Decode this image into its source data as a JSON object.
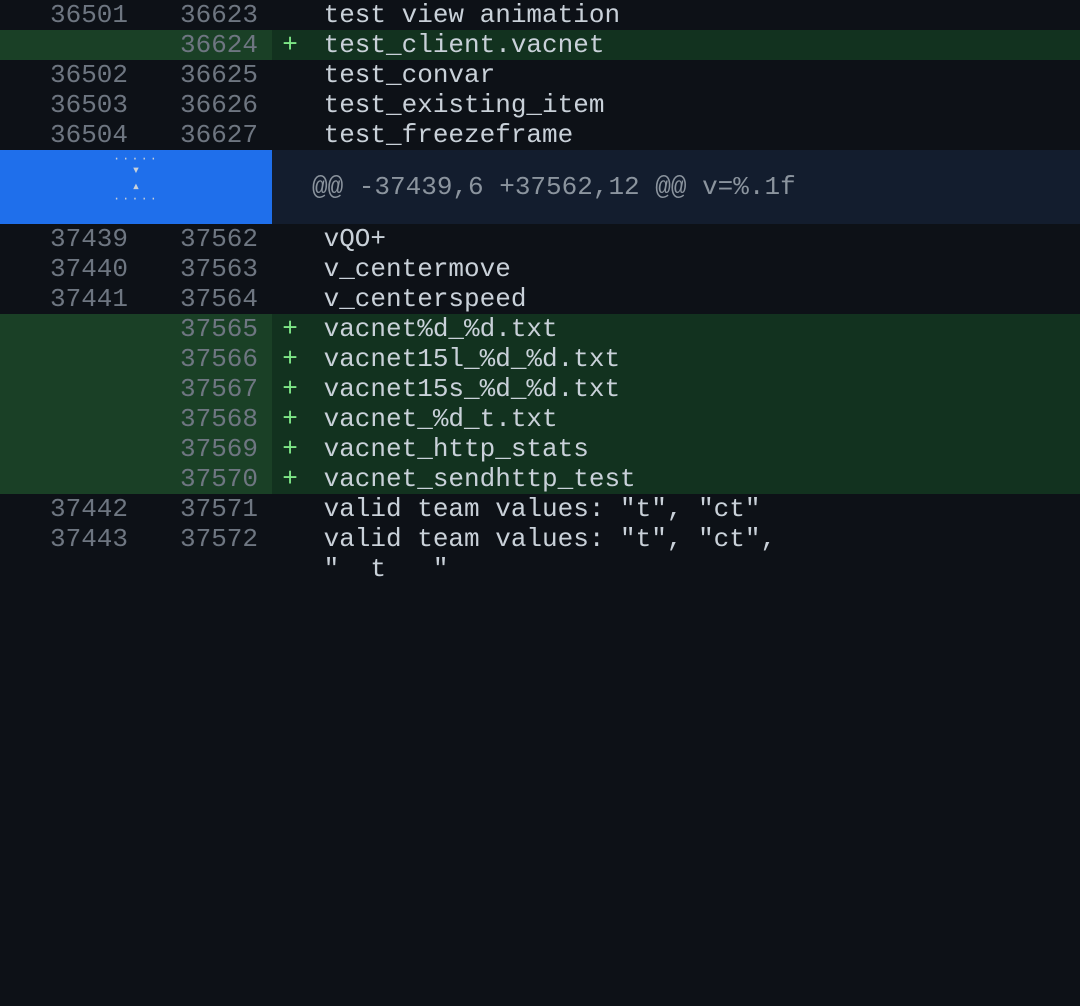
{
  "rows": [
    {
      "type": "context",
      "old": "36501",
      "new": "36623",
      "marker": " ",
      "text": " test view animation"
    },
    {
      "type": "addition",
      "old": "",
      "new": "36624",
      "marker": "+",
      "text": " test_client.vacnet"
    },
    {
      "type": "context",
      "old": "36502",
      "new": "36625",
      "marker": " ",
      "text": " test_convar"
    },
    {
      "type": "context",
      "old": "36503",
      "new": "36626",
      "marker": " ",
      "text": " test_existing_item"
    },
    {
      "type": "context",
      "old": "36504",
      "new": "36627",
      "marker": " ",
      "text": " test_freezeframe"
    },
    {
      "type": "hunk",
      "header": "@@ -37439,6 +37562,12 @@ v=%.1f"
    },
    {
      "type": "context",
      "old": "37439",
      "new": "37562",
      "marker": " ",
      "text": " vQO+"
    },
    {
      "type": "context",
      "old": "37440",
      "new": "37563",
      "marker": " ",
      "text": " v_centermove"
    },
    {
      "type": "context",
      "old": "37441",
      "new": "37564",
      "marker": " ",
      "text": " v_centerspeed"
    },
    {
      "type": "addition",
      "old": "",
      "new": "37565",
      "marker": "+",
      "text": " vacnet%d_%d.txt"
    },
    {
      "type": "addition",
      "old": "",
      "new": "37566",
      "marker": "+",
      "text": " vacnet15l_%d_%d.txt"
    },
    {
      "type": "addition",
      "old": "",
      "new": "37567",
      "marker": "+",
      "text": " vacnet15s_%d_%d.txt"
    },
    {
      "type": "addition",
      "old": "",
      "new": "37568",
      "marker": "+",
      "text": " vacnet_%d_t.txt"
    },
    {
      "type": "addition",
      "old": "",
      "new": "37569",
      "marker": "+",
      "text": " vacnet_http_stats"
    },
    {
      "type": "addition",
      "old": "",
      "new": "37570",
      "marker": "+",
      "text": " vacnet_sendhttp_test"
    },
    {
      "type": "context",
      "old": "37442",
      "new": "37571",
      "marker": " ",
      "text": " valid team values: \"t\", \"ct\""
    },
    {
      "type": "context",
      "old": "37443",
      "new": "37572",
      "marker": " ",
      "text": " valid team values: \"t\", \"ct\","
    },
    {
      "type": "context",
      "old": "",
      "new": "",
      "marker": " ",
      "text": " \"  t   \""
    }
  ]
}
